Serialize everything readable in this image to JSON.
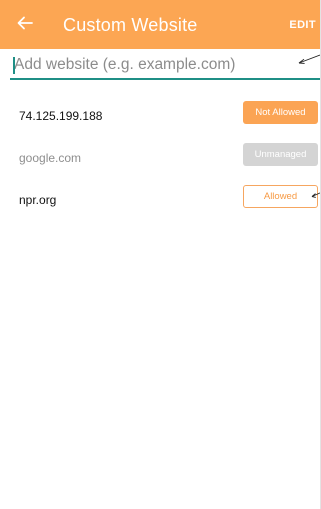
{
  "app_bar": {
    "title": "Custom Website",
    "edit_label": "EDIT",
    "back_icon": "arrow-left-icon",
    "background_color": "#fca653"
  },
  "add_site": {
    "placeholder": "Add website (e.g. example.com)",
    "value": "",
    "accent_color": "#1f8f86"
  },
  "websites": [
    {
      "domain": "74.125.199.188",
      "status": "Not Allowed",
      "status_kind": "not-allowed"
    },
    {
      "domain": "google.com",
      "status": "Unmanaged",
      "status_kind": "unmanaged"
    },
    {
      "domain": "npr.org",
      "status": "Allowed",
      "status_kind": "allowed"
    }
  ],
  "colors": {
    "not_allowed": "#fba454",
    "unmanaged": "#d4d4d4",
    "allowed_border": "#f6a660",
    "allowed_text": "#f79a44"
  }
}
